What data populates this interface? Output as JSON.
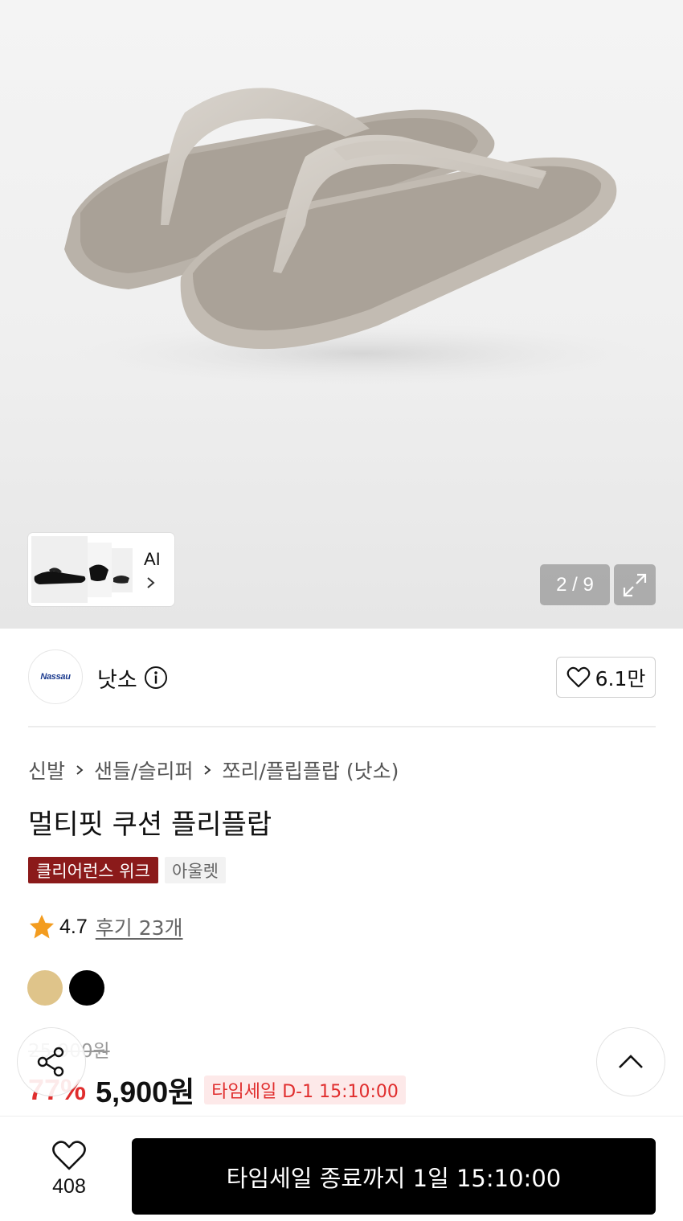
{
  "gallery": {
    "page_indicator": "2 / 9",
    "ai_label": "AI",
    "icons": {
      "expand": "expand-icon",
      "chevron": "chevron-right-icon"
    }
  },
  "brand": {
    "name": "낫소",
    "logo_text": "Nassau",
    "likes": "6.1만",
    "icons": {
      "info": "info-icon",
      "heart": "heart-icon"
    }
  },
  "product": {
    "breadcrumb": [
      "신발",
      "샌들/슬리퍼",
      "쪼리/플립플랍 (낫소)"
    ],
    "title": "멀티핏 쿠션 플리플랍",
    "badges": {
      "clearance": "클리어런스 위크",
      "outlet": "아울렛"
    },
    "rating": {
      "score": "4.7",
      "reviews": "후기 23개"
    },
    "colors": [
      "#dfc48a",
      "#000000"
    ],
    "price": {
      "original": "25,900원",
      "discount": "77%",
      "sale": "5,900원",
      "timesale": "타임세일 D-1 15:10:00"
    }
  },
  "bottom": {
    "wish_count": "408",
    "cta": "타임세일 종료까지 1일 15:10:00"
  },
  "colors": {
    "accent_red": "#e02d2d",
    "clearance_red": "#8b1a1a",
    "cta_bg": "#000000"
  }
}
